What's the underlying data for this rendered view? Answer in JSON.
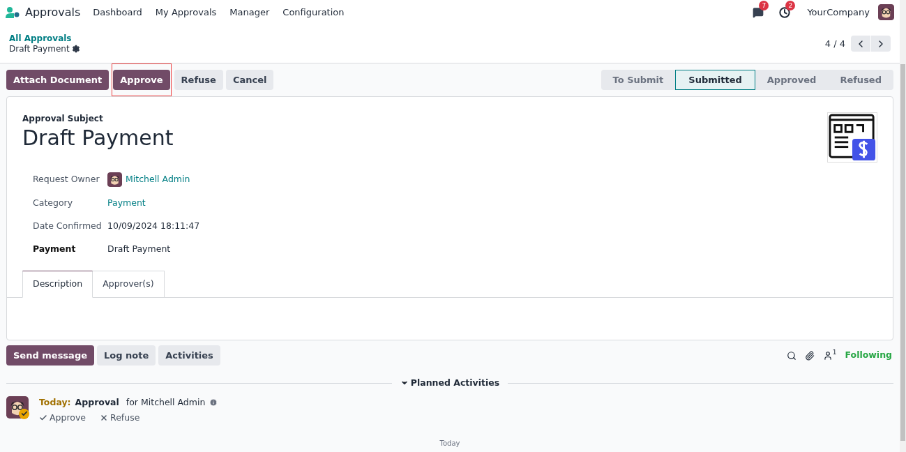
{
  "navbar": {
    "app_name": "Approvals",
    "menu": [
      "Dashboard",
      "My Approvals",
      "Manager",
      "Configuration"
    ],
    "messages_count": "7",
    "activities_count": "2",
    "company": "YourCompany"
  },
  "breadcrumb": {
    "parent": "All Approvals",
    "current": "Draft Payment"
  },
  "pager": {
    "value": "4 / 4"
  },
  "actions": [
    {
      "label": "Attach Document",
      "kind": "primary",
      "highlighted": false
    },
    {
      "label": "Approve",
      "kind": "primary",
      "highlighted": true
    },
    {
      "label": "Refuse",
      "kind": "secondary",
      "highlighted": false
    },
    {
      "label": "Cancel",
      "kind": "secondary",
      "highlighted": false
    }
  ],
  "status_steps": [
    {
      "label": "To Submit",
      "selected": false
    },
    {
      "label": "Submitted",
      "selected": true
    },
    {
      "label": "Approved",
      "selected": false
    },
    {
      "label": "Refused",
      "selected": false
    }
  ],
  "form": {
    "subject_label": "Approval Subject",
    "subject": "Draft Payment",
    "fields": [
      {
        "label": "Request Owner",
        "value": "Mitchell Admin",
        "kind": "user",
        "bold": false
      },
      {
        "label": "Category",
        "value": "Payment",
        "kind": "link",
        "bold": false
      },
      {
        "label": "Date Confirmed",
        "value": "10/09/2024 18:11:47",
        "kind": "text",
        "bold": false
      },
      {
        "label": "Payment",
        "value": "Draft Payment",
        "kind": "text",
        "bold": true
      }
    ],
    "tabs": [
      {
        "label": "Description",
        "selected": true
      },
      {
        "label": "Approver(s)",
        "selected": false
      }
    ]
  },
  "chatter": {
    "buttons": [
      {
        "label": "Send message",
        "kind": "primary"
      },
      {
        "label": "Log note",
        "kind": "secondary"
      },
      {
        "label": "Activities",
        "kind": "secondary"
      }
    ],
    "followers_count": "1",
    "following": "Following",
    "section": "Planned Activities",
    "activity": {
      "due": "Today:",
      "type": "Approval",
      "assignee": "for Mitchell Admin",
      "actions": [
        "Approve",
        "Refuse"
      ]
    },
    "separator": "Today"
  }
}
